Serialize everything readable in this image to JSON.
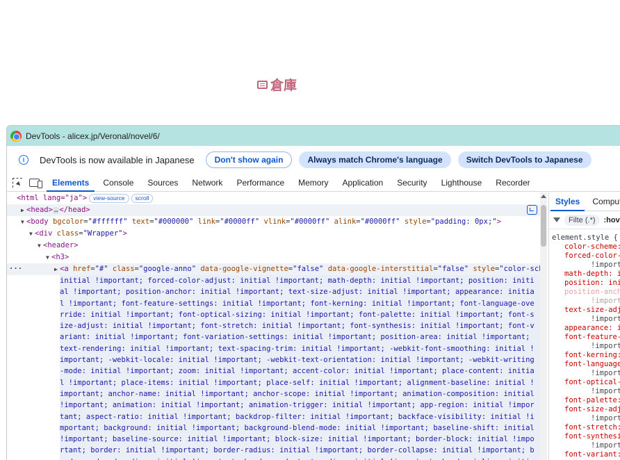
{
  "page": {
    "heading": "倉庫"
  },
  "devtools": {
    "title": "DevTools - alicex.jp/Veronal/novel/6/",
    "infobar": {
      "message": "DevTools is now available in Japanese",
      "dont_show": "Don't show again",
      "always_match": "Always match Chrome's language",
      "switch": "Switch DevTools to Japanese"
    },
    "tabs": [
      "Elements",
      "Console",
      "Sources",
      "Network",
      "Performance",
      "Memory",
      "Application",
      "Security",
      "Lighthouse",
      "Recorder"
    ],
    "active_tab": "Elements",
    "accent_color": "#0b57d0",
    "titlebar_color": "#b4e3e1"
  },
  "dom": {
    "html_open": "<html lang=\"ja\">",
    "view_source": "view-source",
    "scroll": "scroll",
    "head_open": "<head>",
    "ellipsis": "…",
    "head_close": "</head>",
    "body_tag": "<body",
    "body_attrs": [
      {
        "name": "bgcolor",
        "value": "\"#ffffff\""
      },
      {
        "name": "text",
        "value": "\"#000000\""
      },
      {
        "name": "link",
        "value": "\"#0000ff\""
      },
      {
        "name": "vlink",
        "value": "\"#0000ff\""
      },
      {
        "name": "alink",
        "value": "\"#0000ff\""
      },
      {
        "name": "style",
        "value": "\"padding: 0px;\""
      }
    ],
    "div_open": "<div",
    "div_class_name": "class",
    "div_class_value": "\"Wrapper\"",
    "header_open": "<header>",
    "h3_open": "<h3>",
    "a_tag": "<a",
    "a_attrs": [
      {
        "name": "href",
        "value": "\"#\""
      },
      {
        "name": "class",
        "value": "\"google-anno\""
      },
      {
        "name": "data-google-vignette",
        "value": "\"false\""
      },
      {
        "name": "data-google-interstitial",
        "value": "\"false\""
      },
      {
        "name": "style",
        "value": "\"color-scheme:"
      }
    ],
    "style_text": "initial !important; forced-color-adjust: initial !important; math-depth: initial !important; position: initial !important; position-anchor: initial !important; text-size-adjust: initial !important; appearance: initial !important; font-feature-settings: initial !important; font-kerning: initial !important; font-language-override: initial !important; font-optical-sizing: initial !important; font-palette: initial !important; font-size-adjust: initial !important; font-stretch: initial !important; font-synthesis: initial !important; font-variant: initial !important; font-variation-settings: initial !important; position-area: initial !important; text-rendering: initial !important; text-spacing-trim: initial !important; -webkit-font-smoothing: initial !important; -webkit-locale: initial !important; -webkit-text-orientation: initial !important; -webkit-writing-mode: initial !important; zoom: initial !important; accent-color: initial !important; place-content: initial !important; place-items: initial !important; place-self: initial !important; alignment-baseline: initial !important; anchor-name: initial !important; anchor-scope: initial !important; animation-composition: initial !important; animation: initial !important; animation-trigger: initial !important; app-region: initial !important; aspect-ratio: initial !important; backdrop-filter: initial !important; backface-visibility: initial !important; background: initial !important; background-blend-mode: initial !important; baseline-shift: initial !important; baseline-source: initial !important; block-size: initial !important; border-block: initial !important; border: initial !important; border-radius: initial !important; border-collapse: initial !important; border-end-end-radius: initial !important; border-end-start-radius: initial !important; border-inline: initial !important; border-start-end-radius: initial !important; border-start-start-radius: initial !important;"
  },
  "styles_pane": {
    "tabs": [
      "Styles",
      "Computed"
    ],
    "active_tab": "Styles",
    "filter_placeholder": "Filte",
    "filter_regex": "(.*)",
    "hov": ":hov",
    "selector": "element.style {",
    "lines": [
      {
        "kind": "prop",
        "text": "color-scheme:"
      },
      {
        "kind": "prop",
        "text": "forced-color-a"
      },
      {
        "kind": "imp",
        "text": "!importa"
      },
      {
        "kind": "prop",
        "text": "math-depth: i"
      },
      {
        "kind": "prop",
        "text": "position: ini"
      },
      {
        "kind": "propdim",
        "text": "position-ancho"
      },
      {
        "kind": "impdim",
        "text": "!importa"
      },
      {
        "kind": "prop",
        "text": "text-size-adju"
      },
      {
        "kind": "imp",
        "text": "!importa"
      },
      {
        "kind": "prop",
        "text": "appearance: i"
      },
      {
        "kind": "prop",
        "text": "font-feature-s"
      },
      {
        "kind": "imp",
        "text": "!importa"
      },
      {
        "kind": "prop",
        "text": "font-kerning:"
      },
      {
        "kind": "prop",
        "text": "font-language-"
      },
      {
        "kind": "imp",
        "text": "!importa"
      },
      {
        "kind": "prop",
        "text": "font-optical-s"
      },
      {
        "kind": "imp",
        "text": "!importa"
      },
      {
        "kind": "prop",
        "text": "font-palette:"
      },
      {
        "kind": "prop",
        "text": "font-size-adju"
      },
      {
        "kind": "imp",
        "text": "!importa"
      },
      {
        "kind": "prop",
        "text": "font-stretch:"
      },
      {
        "kind": "prop",
        "text": "font-synthesis"
      },
      {
        "kind": "imp",
        "text": "!importa"
      },
      {
        "kind": "prop",
        "text": "font-variant:"
      },
      {
        "kind": "imp",
        "text": "!importa"
      }
    ]
  }
}
